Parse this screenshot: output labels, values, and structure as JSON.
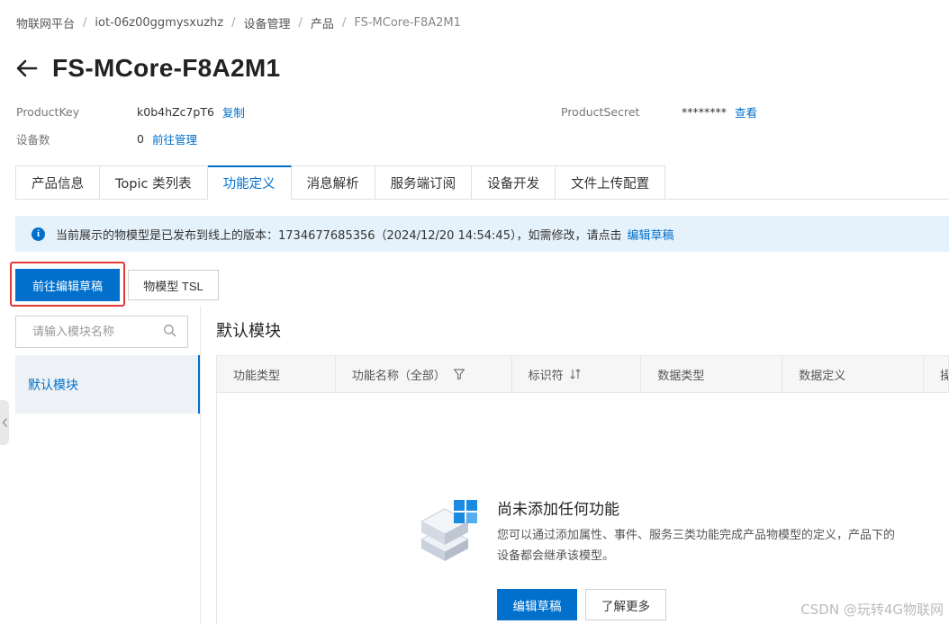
{
  "breadcrumb": [
    "物联网平台",
    "iot-06z00ggmysxuzhz",
    "设备管理",
    "产品",
    "FS-MCore-F8A2M1"
  ],
  "page_title": "FS-MCore-F8A2M1",
  "info": {
    "product_key_label": "ProductKey",
    "product_key_value": "k0b4hZc7pT6",
    "copy_link": "复制",
    "product_secret_label": "ProductSecret",
    "product_secret_value": "********",
    "view_link": "查看",
    "device_count_label": "设备数",
    "device_count_value": "0",
    "manage_link": "前往管理"
  },
  "tabs": [
    {
      "label": "产品信息",
      "active": false
    },
    {
      "label": "Topic 类列表",
      "active": false
    },
    {
      "label": "功能定义",
      "active": true
    },
    {
      "label": "消息解析",
      "active": false
    },
    {
      "label": "服务端订阅",
      "active": false
    },
    {
      "label": "设备开发",
      "active": false
    },
    {
      "label": "文件上传配置",
      "active": false
    }
  ],
  "notice": {
    "text": "当前展示的物模型是已发布到线上的版本：1734677685356（2024/12/20 14:54:45），如需修改，请点击",
    "link": "编辑草稿"
  },
  "toolbar": {
    "primary_label": "前往编辑草稿",
    "tsl_label": "物模型 TSL"
  },
  "sidebar": {
    "search_placeholder": "请输入模块名称",
    "modules": [
      {
        "label": "默认模块",
        "active": true
      }
    ]
  },
  "section_title": "默认模块",
  "table": {
    "columns": [
      "功能类型",
      "功能名称（全部）",
      "标识符",
      "数据类型",
      "数据定义",
      "操作"
    ]
  },
  "empty": {
    "title": "尚未添加任何功能",
    "description": "您可以通过添加属性、事件、服务三类功能完成产品物模型的定义，产品下的设备都会继承该模型。",
    "edit_button": "编辑草稿",
    "learn_button": "了解更多"
  },
  "watermark": "CSDN @玩转4G物联网",
  "colors": {
    "primary": "#0070cc",
    "notice_bg": "#e6f2fb",
    "highlight_border": "#e53935"
  }
}
